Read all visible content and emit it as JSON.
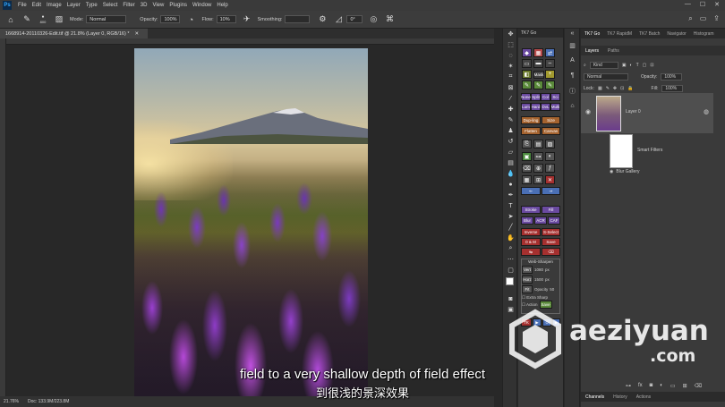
{
  "menu": {
    "logo": "Ps",
    "items": [
      "File",
      "Edit",
      "Image",
      "Layer",
      "Type",
      "Select",
      "Filter",
      "3D",
      "View",
      "Plugins",
      "Window",
      "Help"
    ],
    "window_controls": [
      "—",
      "☐",
      "✕"
    ]
  },
  "options": {
    "brush_size": "800",
    "mode_label": "Mode:",
    "mode_value": "Normal",
    "opacity_label": "Opacity:",
    "opacity_value": "100%",
    "flow_label": "Flow:",
    "flow_value": "10%",
    "smoothing_label": "Smoothing:",
    "angle_value": "0°"
  },
  "document": {
    "tab_title": "1668914-20110326-Edit.tif @ 21.8% (Layer 0, RGB/16) *",
    "zoom": "21.76%",
    "doc_info": "Doc: 133.9M/223.8M"
  },
  "script_panel": {
    "title": "TK7 Go",
    "buttons": {
      "none": "None",
      "split": "Split",
      "color": "Col",
      "select": "Sci",
      "lum": "Lum",
      "hard": "Hard",
      "dvl": "DvL",
      "multi": "Multi",
      "dup": "Dup-ling",
      "size": "Size",
      "flatten": "Flatten",
      "canvas": "Canvas",
      "stroke": "Stroke",
      "fill": "Fill",
      "blur": "Blur",
      "acr": "ACR",
      "caf": "CAF",
      "inverse": "Inverse",
      "sselect": "S-Select",
      "oam": "0 & M",
      "save": "Save",
      "web_sharpen": "Web-Sharpen",
      "vert": "Vert",
      "horz": "Horz",
      "fit": "Fit",
      "vert_val": "1080",
      "horz_val": "1500",
      "px": "px",
      "opacity_label": "Opacity",
      "opacity_val": "50",
      "extra_sharp": "Extra Sharp",
      "action": "Action",
      "save2": "Save",
      "tk": "TK"
    }
  },
  "right_panel": {
    "top_tabs": [
      "TK7 Go",
      "TK7 RapidM",
      "TK7 Batch",
      "Navigator",
      "Histogram"
    ],
    "layer_tabs": [
      "Layers",
      "Paths"
    ],
    "kind_label": "Kind",
    "blend_mode": "Normal",
    "opacity_label": "Opacity:",
    "opacity_value": "100%",
    "lock_label": "Lock:",
    "fill_label": "Fill:",
    "fill_value": "100%",
    "layer_name": "Layer 0",
    "smart_filters": "Smart Filters",
    "blur_gallery": "Blur Gallery",
    "bottom_tabs": [
      "Channels",
      "History",
      "Actions"
    ]
  },
  "subtitles": {
    "english": "field to a very shallow depth of field effect",
    "chinese": "到很浅的景深效果"
  },
  "watermark": {
    "brand": "aeziyuan",
    "tld": ".com"
  },
  "colors": {
    "ps_blue": "#31a8ff",
    "panel_bg": "#3a3a3a",
    "canvas_bg": "#282828",
    "script_purple": "#6a4aa0",
    "script_red": "#a5302f"
  }
}
